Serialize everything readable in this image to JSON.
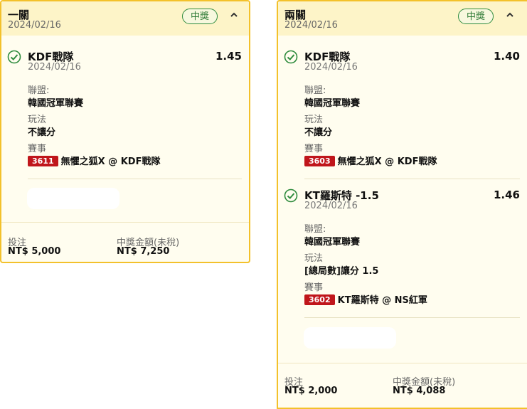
{
  "cards": [
    {
      "title": "一關",
      "date": "2024/02/16",
      "status": "中獎",
      "collapse_icon": "chevron-up-icon",
      "selections": [
        {
          "name": "KDF戰隊",
          "date": "2024/02/16",
          "odds": "1.45",
          "league_label": "聯盟:",
          "league": "韓國冠軍聯賽",
          "bet_type_label": "玩法",
          "bet_type": "不讓分",
          "event_label": "賽事",
          "event_code": "3611",
          "event": "無懼之狐X @ KDF戰隊"
        }
      ],
      "stake_label": "投注",
      "stake": "NT$ 5,000",
      "payout_label": "中獎金額(未稅)",
      "payout": "NT$ 7,250"
    },
    {
      "title": "兩關",
      "date": "2024/02/16",
      "status": "中獎",
      "collapse_icon": "chevron-up-icon",
      "selections": [
        {
          "name": "KDF戰隊",
          "date": "2024/02/16",
          "odds": "1.40",
          "league_label": "聯盟:",
          "league": "韓國冠軍聯賽",
          "bet_type_label": "玩法",
          "bet_type": "不讓分",
          "event_label": "賽事",
          "event_code": "3603",
          "event": "無懼之狐X @ KDF戰隊"
        },
        {
          "name": "KT羅斯特 -1.5",
          "date": "2024/02/16",
          "odds": "1.46",
          "league_label": "聯盟:",
          "league": "韓國冠軍聯賽",
          "bet_type_label": "玩法",
          "bet_type": "[總局數]讓分 1.5",
          "event_label": "賽事",
          "event_code": "3602",
          "event": "KT羅斯特 @ NS紅軍"
        }
      ],
      "stake_label": "投注",
      "stake": "NT$ 2,000",
      "payout_label": "中獎金額(未稅)",
      "payout": "NT$ 4,088"
    }
  ],
  "colors": {
    "card_border": "#f3c12b",
    "card_bg": "#fffdef",
    "header_bg": "#fdf4c8",
    "win_green": "#2e8b3d",
    "event_code_red": "#c0161b"
  }
}
